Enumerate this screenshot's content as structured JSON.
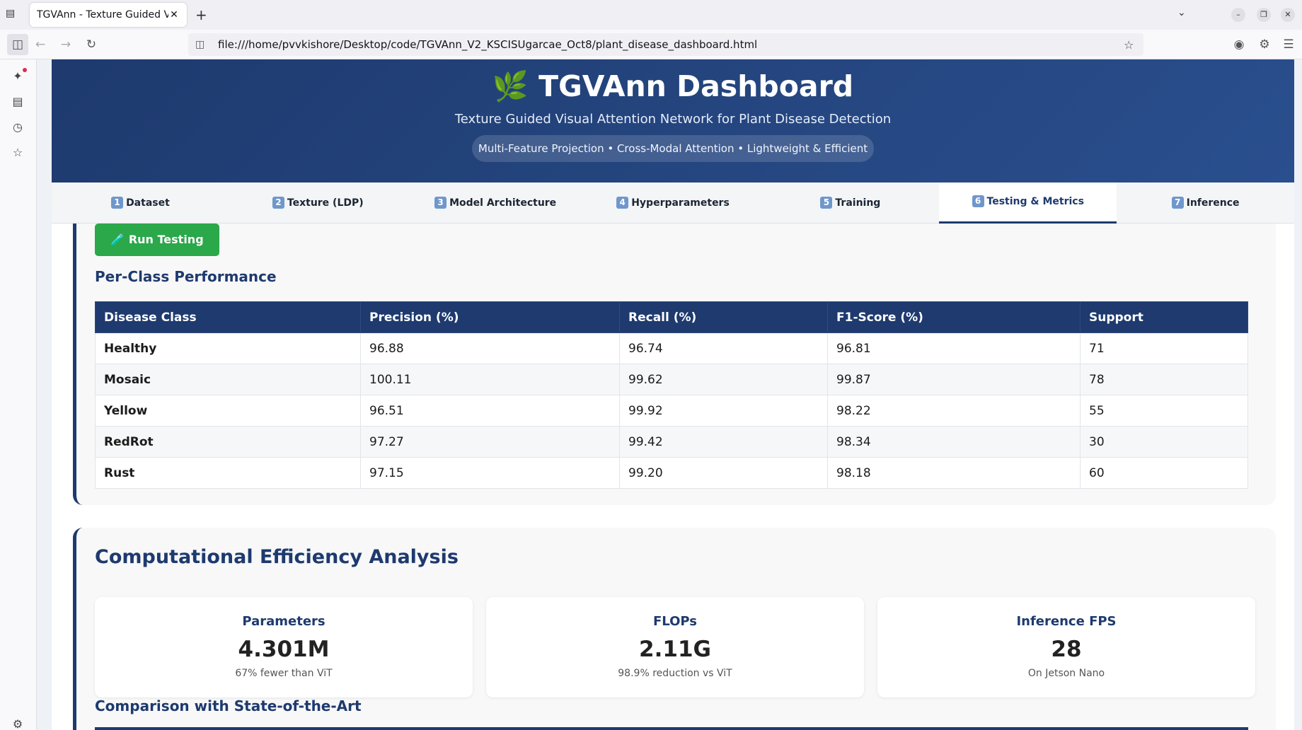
{
  "browser": {
    "tab_title": "TGVAnn - Texture Guided Vis",
    "url": "file:///home/pvvkishore/Desktop/code/TGVAnn_V2_KSCISUgarcae_Oct8/plant_disease_dashboard.html"
  },
  "header": {
    "title": "🌿 TGVAnn Dashboard",
    "subtitle": "Texture Guided Visual Attention Network for Plant Disease Detection",
    "pill": "Multi-Feature Projection • Cross-Modal Attention • Lightweight & Efficient"
  },
  "tabs": [
    {
      "num": "1",
      "label": "Dataset"
    },
    {
      "num": "2",
      "label": "Texture (LDP)"
    },
    {
      "num": "3",
      "label": "Model Architecture"
    },
    {
      "num": "4",
      "label": "Hyperparameters"
    },
    {
      "num": "5",
      "label": "Training"
    },
    {
      "num": "6",
      "label": "Testing & Metrics"
    },
    {
      "num": "7",
      "label": "Inference"
    }
  ],
  "testing": {
    "run_button": "🧪 Run Testing",
    "per_class_title": "Per-Class Performance",
    "columns": [
      "Disease Class",
      "Precision (%)",
      "Recall (%)",
      "F1-Score (%)",
      "Support"
    ],
    "rows": [
      [
        "Healthy",
        "96.88",
        "96.74",
        "96.81",
        "71"
      ],
      [
        "Mosaic",
        "100.11",
        "99.62",
        "99.87",
        "78"
      ],
      [
        "Yellow",
        "96.51",
        "99.92",
        "98.22",
        "55"
      ],
      [
        "RedRot",
        "97.27",
        "99.42",
        "98.34",
        "30"
      ],
      [
        "Rust",
        "97.15",
        "99.20",
        "98.18",
        "60"
      ]
    ]
  },
  "efficiency": {
    "title": "Computational Efficiency Analysis",
    "cards": [
      {
        "label": "Parameters",
        "value": "4.301M",
        "note": "67% fewer than ViT"
      },
      {
        "label": "FLOPs",
        "value": "2.11G",
        "note": "98.9% reduction vs ViT"
      },
      {
        "label": "Inference FPS",
        "value": "28",
        "note": "On Jetson Nano"
      }
    ],
    "comparison_title": "Comparison with State-of-the-Art"
  }
}
